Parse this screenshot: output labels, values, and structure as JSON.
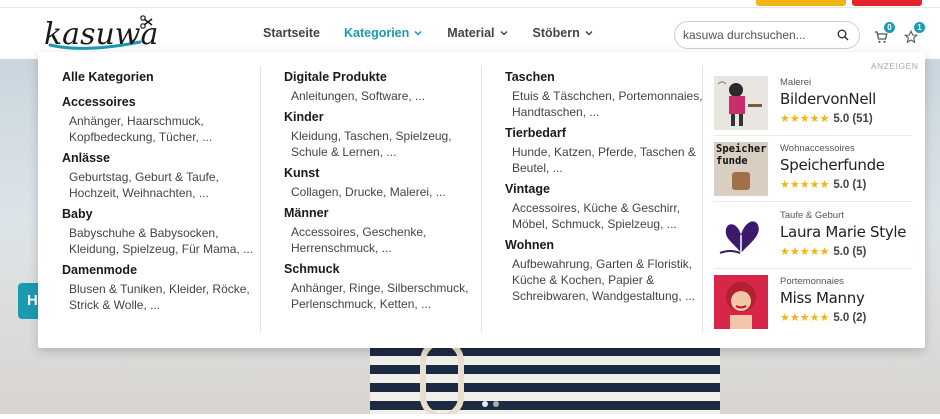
{
  "header": {
    "logo_text": "kasuwa",
    "nav": [
      {
        "label": "Startseite",
        "has_menu": false,
        "active": false
      },
      {
        "label": "Kategorien",
        "has_menu": true,
        "active": true
      },
      {
        "label": "Material",
        "has_menu": true,
        "active": false
      },
      {
        "label": "Stöbern",
        "has_menu": true,
        "active": false
      }
    ],
    "search_placeholder": "kasuwa durchsuchen...",
    "cart_count": "0",
    "favorites_count": "1"
  },
  "hero": {
    "button_text": "H"
  },
  "mega_menu": {
    "columns": [
      {
        "groups": [
          {
            "title": "Alle Kategorien",
            "sub": ""
          },
          {
            "title": "Accessoires",
            "sub": "Anhänger, Haarschmuck, Kopfbedeckung, Tücher, ..."
          },
          {
            "title": "Anlässe",
            "sub": "Geburtstag, Geburt & Taufe, Hochzeit, Weihnachten, ..."
          },
          {
            "title": "Baby",
            "sub": "Babyschuhe & Babysocken, Kleidung, Spielzeug, Für Mama, ..."
          },
          {
            "title": "Damenmode",
            "sub": "Blusen & Tuniken, Kleider, Röcke, Strick & Wolle, ..."
          }
        ]
      },
      {
        "groups": [
          {
            "title": "Digitale Produkte",
            "sub": "Anleitungen, Software, ..."
          },
          {
            "title": "Kinder",
            "sub": "Kleidung, Taschen, Spielzeug, Schule & Lernen, ..."
          },
          {
            "title": "Kunst",
            "sub": "Collagen, Drucke, Malerei, ..."
          },
          {
            "title": "Männer",
            "sub": "Accessoires, Geschenke, Herrenschmuck, ..."
          },
          {
            "title": "Schmuck",
            "sub": "Anhänger, Ringe, Silberschmuck, Perlenschmuck, Ketten, ..."
          }
        ]
      },
      {
        "groups": [
          {
            "title": "Taschen",
            "sub": "Etuis & Täschchen, Portemonnaies, Handtaschen, ..."
          },
          {
            "title": "Tierbedarf",
            "sub": "Hunde, Katzen, Pferde, Taschen & Beutel, ..."
          },
          {
            "title": "Vintage",
            "sub": "Accessoires, Küche & Geschirr, Möbel, Schmuck, Spielzeug, ..."
          },
          {
            "title": "Wohnen",
            "sub": "Aufbewahrung, Garten & Floristik, Küche & Kochen, Papier & Schreibwaren, Wandgestaltung, ..."
          }
        ]
      }
    ],
    "ad_label": "ANZEIGEN",
    "sellers": [
      {
        "category": "Malerei",
        "name": "BildervonNell",
        "stars": "★★★★★",
        "score": "5.0",
        "count": "(51)",
        "thumb_text": ""
      },
      {
        "category": "Wohnaccessoires",
        "name": "Speicherfunde",
        "stars": "★★★★★",
        "score": "5.0",
        "count": "(1)",
        "thumb_text": "Speicher-funde"
      },
      {
        "category": "Taufe & Geburt",
        "name": "Laura Marie Style",
        "stars": "★★★★★",
        "score": "5.0",
        "count": "(5)",
        "thumb_text": ""
      },
      {
        "category": "Portemonnaies",
        "name": "Miss Manny",
        "stars": "★★★★★",
        "score": "5.0",
        "count": "(2)",
        "thumb_text": ""
      }
    ]
  },
  "colors": {
    "accent": "#1b9bb0",
    "star": "#f2b517",
    "top_yellow": "#f2b517",
    "top_red": "#e3242b"
  }
}
